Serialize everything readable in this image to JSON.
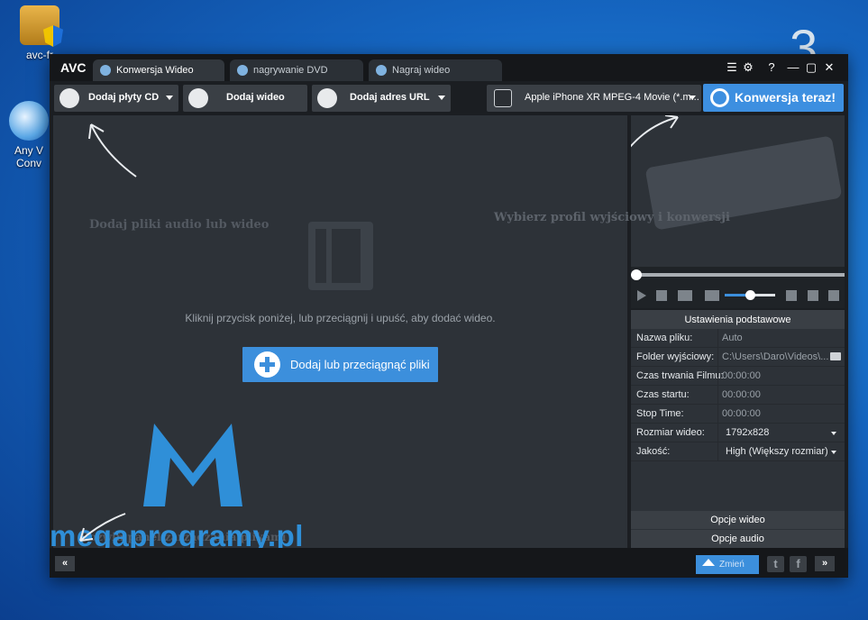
{
  "desktop": {
    "icons": [
      {
        "label": "avc-fr",
        "icon": "installer-icon"
      },
      {
        "label": "Any V Conv",
        "icon": "avc-shortcut-icon"
      }
    ],
    "step_number": "3"
  },
  "window": {
    "logo": "AVC",
    "tabs": [
      {
        "label": "Konwersja Wideo",
        "active": true,
        "icon": "convert-icon"
      },
      {
        "label": "nagrywanie DVD",
        "active": false,
        "icon": "disc-icon"
      },
      {
        "label": "Nagraj wideo",
        "active": false,
        "icon": "record-icon"
      }
    ],
    "controls": {
      "menu": "☰",
      "settings": "⚙",
      "help": "?",
      "minimize": "—",
      "maximize": "▢",
      "close": "✕"
    }
  },
  "toolbar": {
    "add_cd": "Dodaj płyty CD",
    "add_video": "Dodaj wideo",
    "add_url": "Dodaj adres URL",
    "profile": "Apple iPhone XR MPEG-4 Movie (*.m...",
    "convert": "Konwersja teraz!"
  },
  "main": {
    "hint_add": "Dodaj pliki audio lub wideo",
    "hint_profile": "Wybierz profil wyjściowy i konwersji",
    "empty_message": "Kliknij przycisk poniżej, lub przeciągnij i upuść, aby dodać wideo.",
    "add_button": "Dodaj lub przeciągnąć pliki",
    "watermark": "megaprogramy.pl",
    "bottom_hint": "Rozwiń panel zarządzania plikami"
  },
  "player": {
    "seek_position": 0,
    "volume": 0.5
  },
  "settings": {
    "title": "Ustawienia podstawowe",
    "rows": [
      {
        "key": "Nazwa pliku:",
        "value": "Auto"
      },
      {
        "key": "Folder wyjściowy:",
        "value": "C:\\Users\\Daro\\Videos\\..."
      },
      {
        "key": "Czas trwania Filmu:",
        "value": "00:00:00"
      },
      {
        "key": "Czas startu:",
        "value": "00:00:00"
      },
      {
        "key": "Stop Time:",
        "value": "00:00:00"
      },
      {
        "key": "Rozmiar wideo:",
        "value": "1792x828"
      },
      {
        "key": "Jakość:",
        "value": "High (Większy rozmiar)"
      }
    ],
    "video_options": "Opcje wideo",
    "audio_options": "Opcje audio"
  },
  "statusbar": {
    "collapse": "«",
    "change": "Zmień",
    "expand": "»",
    "twitter": "t",
    "facebook": "f"
  },
  "colors": {
    "accent": "#3c8fdc",
    "panel": "#2d3238",
    "window": "#1b1e22"
  }
}
